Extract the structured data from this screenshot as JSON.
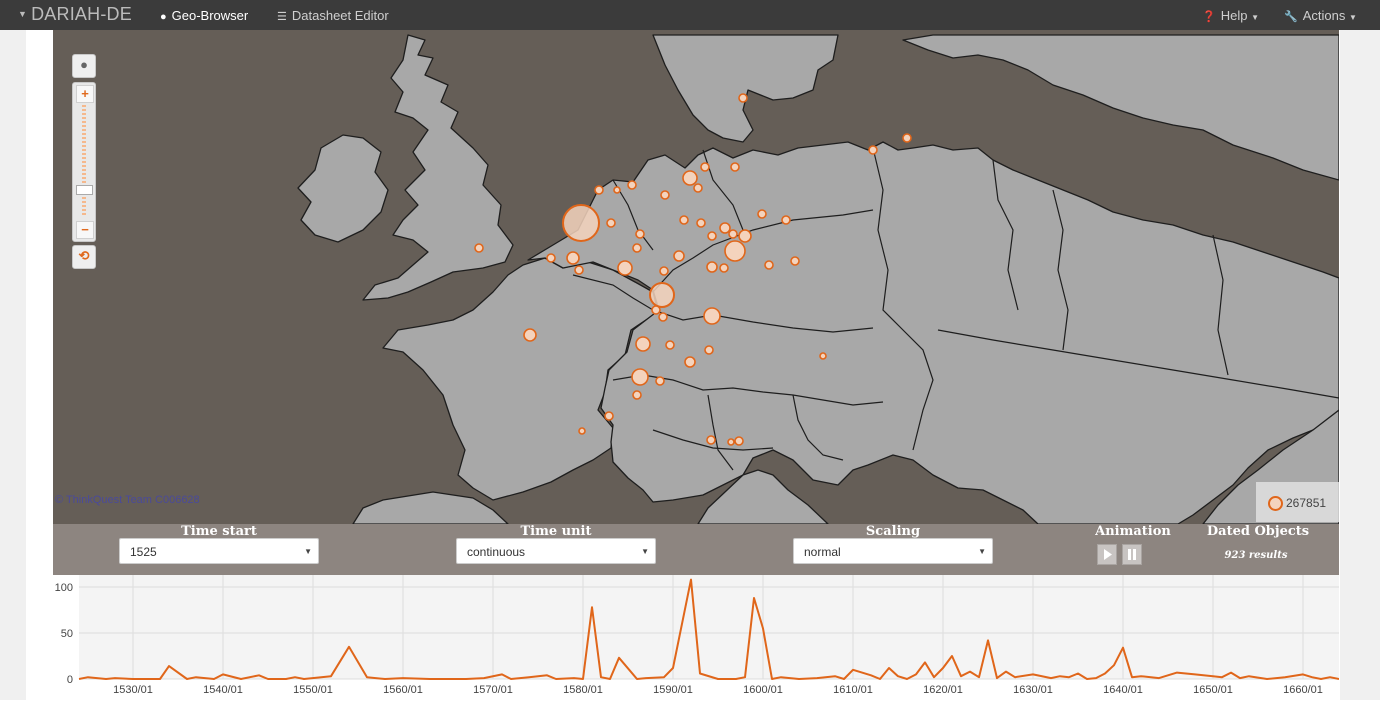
{
  "nav": {
    "brand": "DARIAH-DE",
    "items": [
      {
        "label": "Geo-Browser",
        "icon": "globe-icon",
        "active": true
      },
      {
        "label": "Datasheet Editor",
        "icon": "list-icon",
        "active": false
      }
    ],
    "help": "Help",
    "actions": "Actions"
  },
  "map": {
    "attribution": "© ThinkQuest Team C006628",
    "legend_count": "267851",
    "colors": {
      "sea": "#655e57",
      "land": "#a8a8a8",
      "point_fill": "#f4d3bd",
      "point_stroke": "#e0661a"
    }
  },
  "controls": {
    "time_start": {
      "label": "Time start",
      "value": "1525"
    },
    "time_unit": {
      "label": "Time unit",
      "value": "continuous"
    },
    "scaling": {
      "label": "Scaling",
      "value": "normal"
    },
    "animation": {
      "label": "Animation"
    },
    "dated_objects": {
      "label": "Dated Objects",
      "results": "923 results"
    }
  },
  "chart_data": {
    "type": "line",
    "ylim": [
      0,
      100
    ],
    "yticks": [
      0,
      50,
      100
    ],
    "xlim": [
      1524,
      1664
    ],
    "xticks": [
      "1530/01",
      "1540/01",
      "1550/01",
      "1560/01",
      "1570/01",
      "1580/01",
      "1590/01",
      "1600/01",
      "1610/01",
      "1620/01",
      "1630/01",
      "1640/01",
      "1650/01",
      "1660/01"
    ],
    "grid": true,
    "color": "#e0661a",
    "series": [
      {
        "x": [
          1524,
          1525,
          1527,
          1528,
          1530,
          1533,
          1534,
          1536,
          1537,
          1539,
          1540,
          1542,
          1544,
          1545,
          1547,
          1548,
          1549,
          1552,
          1554,
          1556,
          1558,
          1560,
          1563,
          1565,
          1567,
          1569,
          1571,
          1572,
          1574,
          1576,
          1577,
          1579,
          1580,
          1581,
          1582,
          1583,
          1584,
          1586,
          1587,
          1589,
          1590,
          1591,
          1592,
          1593,
          1595,
          1597,
          1598,
          1599,
          1600,
          1601,
          1602,
          1604,
          1606,
          1608,
          1609,
          1610,
          1612,
          1613,
          1614,
          1615,
          1616,
          1617,
          1618,
          1619,
          1620,
          1621,
          1622,
          1623,
          1624,
          1625,
          1626,
          1627,
          1628,
          1630,
          1632,
          1633,
          1634,
          1635,
          1636,
          1637,
          1638,
          1639,
          1640,
          1641,
          1642,
          1644,
          1646,
          1648,
          1650,
          1651,
          1652,
          1653,
          1654,
          1656,
          1658,
          1660,
          1661,
          1662,
          1663,
          1664
        ],
        "y": [
          0,
          2,
          0,
          1,
          0,
          0,
          14,
          0,
          2,
          0,
          5,
          0,
          4,
          0,
          0,
          2,
          0,
          3,
          35,
          2,
          0,
          1,
          0,
          0,
          0,
          1,
          5,
          0,
          2,
          4,
          0,
          1,
          0,
          78,
          2,
          0,
          23,
          0,
          1,
          2,
          12,
          60,
          108,
          6,
          0,
          0,
          2,
          88,
          55,
          0,
          2,
          0,
          1,
          3,
          0,
          10,
          4,
          0,
          12,
          3,
          0,
          5,
          18,
          2,
          12,
          25,
          3,
          8,
          2,
          42,
          1,
          8,
          2,
          5,
          1,
          3,
          2,
          6,
          0,
          1,
          6,
          15,
          34,
          2,
          3,
          1,
          7,
          5,
          3,
          2,
          7,
          1,
          3,
          0,
          2,
          5,
          2,
          0,
          2,
          0
        ]
      }
    ]
  }
}
